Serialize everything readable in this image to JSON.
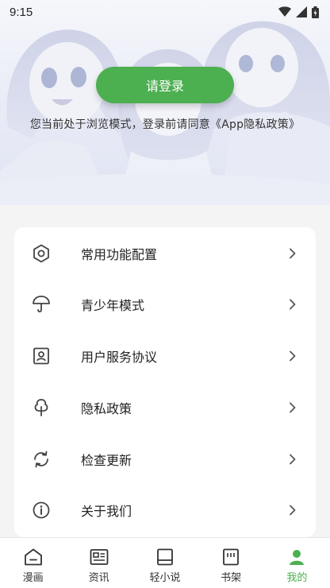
{
  "status_bar": {
    "time": "9:15"
  },
  "hero": {
    "login_label": "请登录",
    "hint": "您当前处于浏览模式，登录前请同意《App隐私政策》"
  },
  "menu": {
    "items": [
      {
        "label": "常用功能配置",
        "icon": "gear-icon"
      },
      {
        "label": "青少年模式",
        "icon": "umbrella-icon"
      },
      {
        "label": "用户服务协议",
        "icon": "profile-card-icon"
      },
      {
        "label": "隐私政策",
        "icon": "tree-icon"
      },
      {
        "label": "检查更新",
        "icon": "refresh-icon"
      },
      {
        "label": "关于我们",
        "icon": "info-icon"
      }
    ]
  },
  "bottom_nav": {
    "items": [
      {
        "label": "漫画",
        "icon": "home-icon"
      },
      {
        "label": "资讯",
        "icon": "news-icon"
      },
      {
        "label": "轻小说",
        "icon": "book-icon"
      },
      {
        "label": "书架",
        "icon": "bookshelf-icon"
      },
      {
        "label": "我的",
        "icon": "profile-icon"
      }
    ]
  },
  "colors": {
    "accent": "#4caf50"
  }
}
